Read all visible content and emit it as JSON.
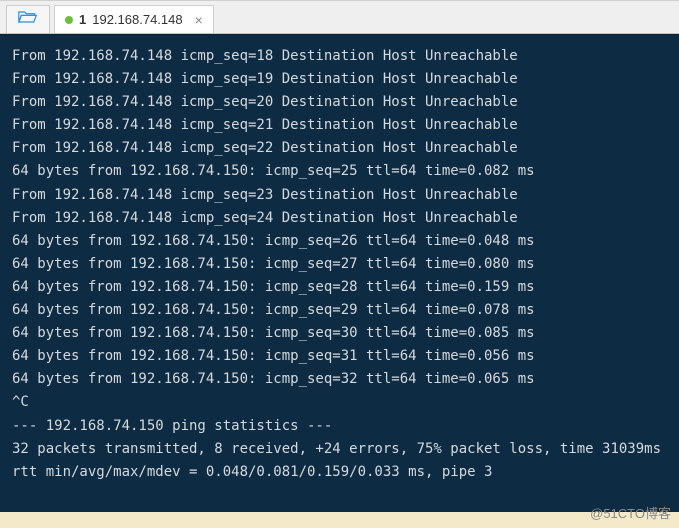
{
  "tab": {
    "index": "1",
    "label": "192.168.74.148",
    "close_glyph": "×"
  },
  "lines": [
    "From 192.168.74.148 icmp_seq=18 Destination Host Unreachable",
    "From 192.168.74.148 icmp_seq=19 Destination Host Unreachable",
    "From 192.168.74.148 icmp_seq=20 Destination Host Unreachable",
    "From 192.168.74.148 icmp_seq=21 Destination Host Unreachable",
    "From 192.168.74.148 icmp_seq=22 Destination Host Unreachable",
    "64 bytes from 192.168.74.150: icmp_seq=25 ttl=64 time=0.082 ms",
    "From 192.168.74.148 icmp_seq=23 Destination Host Unreachable",
    "From 192.168.74.148 icmp_seq=24 Destination Host Unreachable",
    "64 bytes from 192.168.74.150: icmp_seq=26 ttl=64 time=0.048 ms",
    "64 bytes from 192.168.74.150: icmp_seq=27 ttl=64 time=0.080 ms",
    "64 bytes from 192.168.74.150: icmp_seq=28 ttl=64 time=0.159 ms",
    "64 bytes from 192.168.74.150: icmp_seq=29 ttl=64 time=0.078 ms",
    "64 bytes from 192.168.74.150: icmp_seq=30 ttl=64 time=0.085 ms",
    "64 bytes from 192.168.74.150: icmp_seq=31 ttl=64 time=0.056 ms",
    "64 bytes from 192.168.74.150: icmp_seq=32 ttl=64 time=0.065 ms",
    "^C",
    "--- 192.168.74.150 ping statistics ---",
    "32 packets transmitted, 8 received, +24 errors, 75% packet loss, time 31039ms",
    "rtt min/avg/max/mdev = 0.048/0.081/0.159/0.033 ms, pipe 3"
  ],
  "watermark": "@51CTO博客"
}
